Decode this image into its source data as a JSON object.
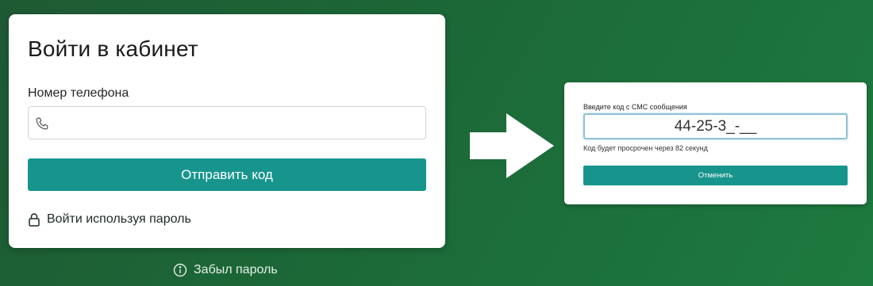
{
  "login": {
    "title": "Войти в кабинет",
    "phone_label": "Номер телефона",
    "phone_value": "",
    "send_button": "Отправить код",
    "password_link": "Войти используя пароль"
  },
  "forgot_password": "Забыл пароль",
  "sms": {
    "label": "Введите код с СМС сообщения",
    "code_value": "44-25-3_-__",
    "hint": "Код будет просрочен через 82 секунд",
    "cancel_button": "Отменить"
  },
  "icons": {
    "phone": "phone-icon",
    "lock": "lock-icon",
    "info": "info-icon",
    "arrow": "arrow-right-icon"
  },
  "colors": {
    "accent": "#17958d",
    "background": "#1c6837"
  }
}
